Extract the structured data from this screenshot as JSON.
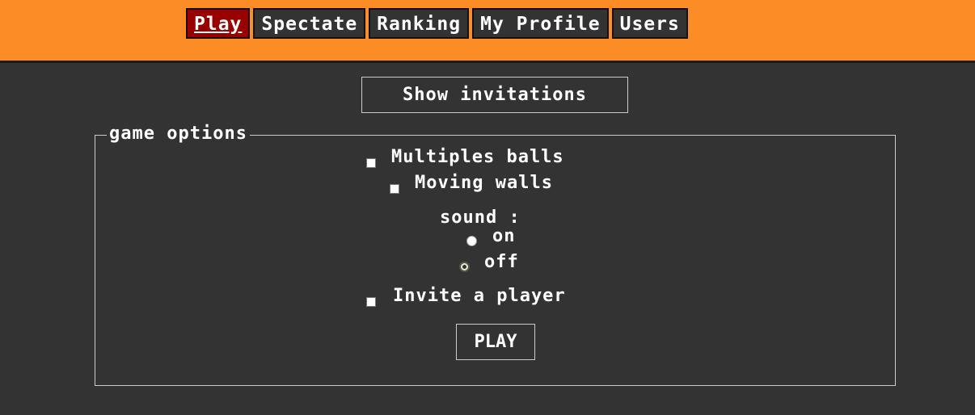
{
  "nav": {
    "items": [
      {
        "label": "Play",
        "active": true
      },
      {
        "label": "Spectate",
        "active": false
      },
      {
        "label": "Ranking",
        "active": false
      },
      {
        "label": "My Profile",
        "active": false
      },
      {
        "label": "Users",
        "active": false
      }
    ]
  },
  "show_invitations_label": "Show invitations",
  "game_options": {
    "legend": "game options",
    "multiple_balls_label": "Multiples balls",
    "multiple_balls_checked": false,
    "moving_walls_label": "Moving walls",
    "moving_walls_checked": false,
    "sound_label": "sound :",
    "sound_on_label": "on",
    "sound_off_label": "off",
    "sound_selected": "off",
    "invite_label": "Invite a player",
    "invite_checked": false,
    "play_label": "PLAY"
  },
  "colors": {
    "header_bg": "#fb8c26",
    "page_bg": "#333333",
    "active_tab": "#990000"
  }
}
